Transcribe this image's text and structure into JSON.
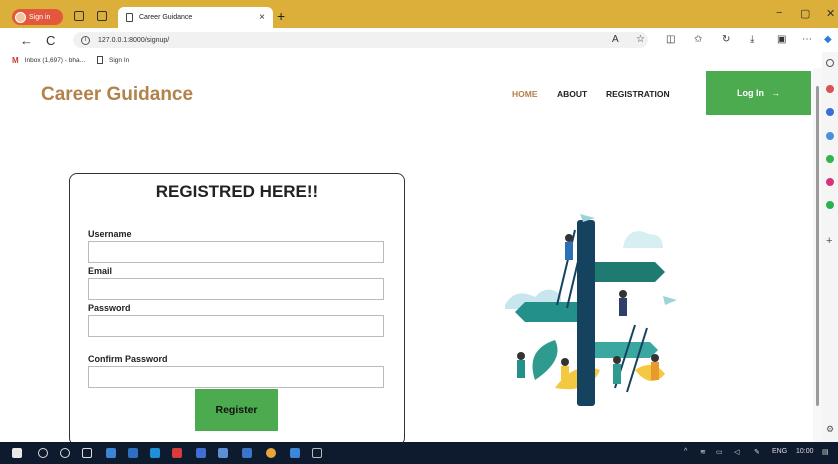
{
  "browser": {
    "profile_label": "Sign in",
    "tab_title": "Career Guidance",
    "tab_close": "×",
    "new_tab": "+",
    "url": "127.0.0.1:8000/signup/",
    "bookmarks": [
      {
        "label": "Inbox (1,697) - bha...",
        "icon": "gmail-icon"
      },
      {
        "label": "Sign In",
        "icon": "page-icon"
      }
    ],
    "window_controls": {
      "minimize": "−",
      "maximize": "▢",
      "close": "✕"
    },
    "nav_icons": {
      "back": "←",
      "reload": "C"
    }
  },
  "site": {
    "brand": "Career Guidance",
    "nav": [
      {
        "label": "HOME",
        "active": true
      },
      {
        "label": "ABOUT",
        "active": false
      },
      {
        "label": "REGISTRATION",
        "active": false
      }
    ],
    "login_label": "Log In",
    "login_arrow": "→"
  },
  "form": {
    "title": "REGISTRED HERE!!",
    "fields": [
      {
        "label": "Username",
        "value": "",
        "type": "text"
      },
      {
        "label": "Email",
        "value": "",
        "type": "email"
      },
      {
        "label": "Password",
        "value": "",
        "type": "password"
      },
      {
        "label": "Confirm Password",
        "value": "",
        "type": "password"
      }
    ],
    "submit_label": "Register"
  },
  "taskbar": {
    "tray": {
      "language": "ENG",
      "time": "10:00"
    }
  },
  "colors": {
    "brand": "#b2824a",
    "accent_green": "#4caa4f",
    "tab_bar": "#dcae3a",
    "taskbar": "#0e1a2e"
  }
}
